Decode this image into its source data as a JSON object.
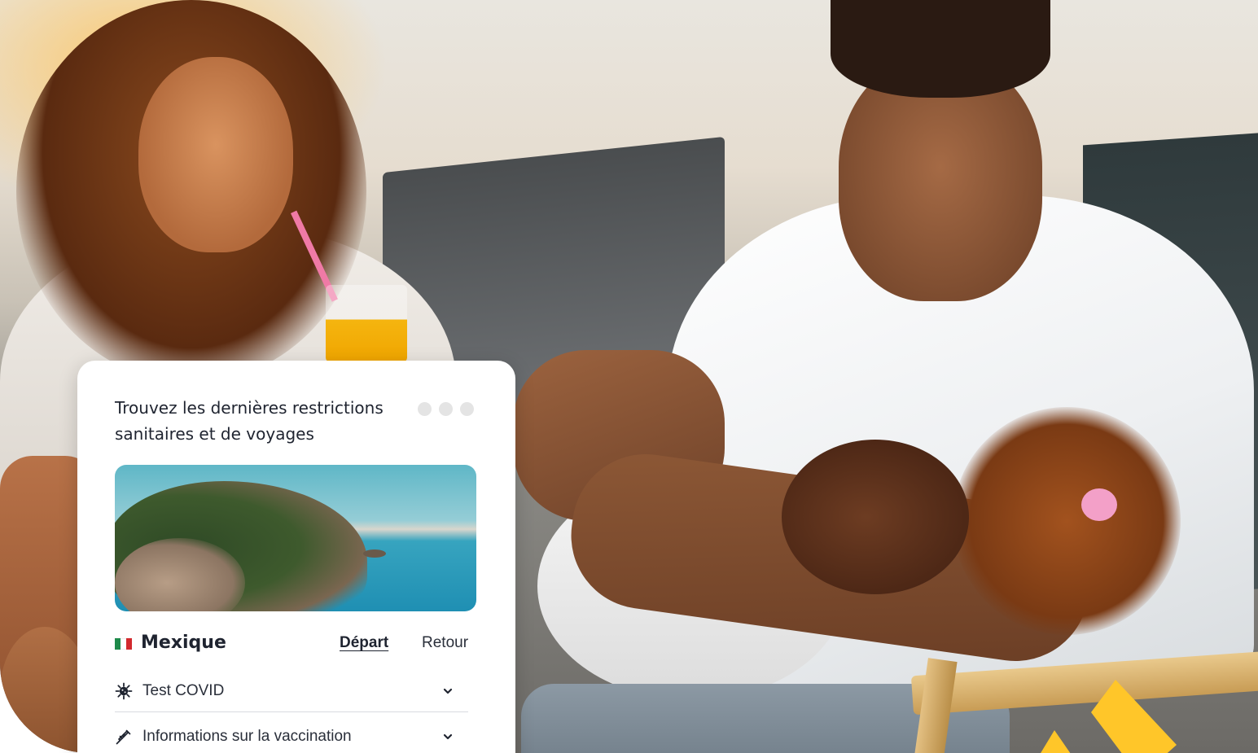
{
  "card": {
    "title": "Trouvez les dernières restrictions sanitaires et de voyages",
    "country": "Mexique",
    "tabs": {
      "departure": "Départ",
      "return": "Retour"
    },
    "accordion": [
      {
        "label": "Test COVID",
        "icon": "virus-icon"
      },
      {
        "label": "Informations sur la vaccination",
        "icon": "syringe-icon"
      }
    ]
  },
  "colors": {
    "text_primary": "#1f2430",
    "accent_yellow": "#ffc629",
    "card_background": "#ffffff"
  }
}
